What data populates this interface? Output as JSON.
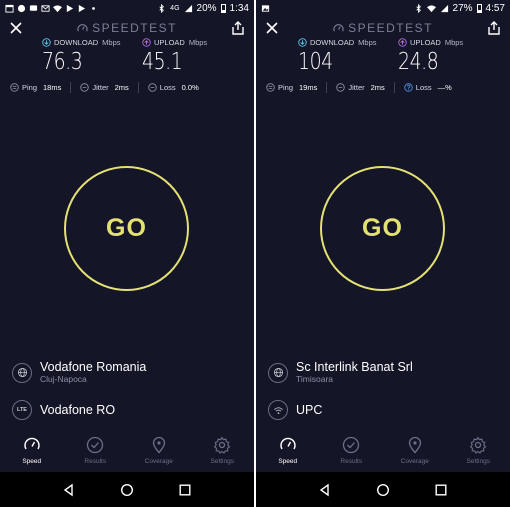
{
  "screens": [
    {
      "status": {
        "signal": "4G",
        "battery": "20%",
        "time": "1:34"
      },
      "logo": "SPEEDTEST",
      "download": {
        "label": "DOWNLOAD",
        "unit": "Mbps",
        "value": "76.3"
      },
      "upload": {
        "label": "UPLOAD",
        "unit": "Mbps",
        "value": "45.1"
      },
      "ping": {
        "label": "Ping",
        "value": "18ms"
      },
      "jitter": {
        "label": "Jitter",
        "value": "2ms"
      },
      "loss": {
        "label": "Loss",
        "value": "0.0%"
      },
      "go_label": "GO",
      "isp": {
        "name": "Vodafone Romania",
        "location": "Cluj-Napoca"
      },
      "network": {
        "badge": "LTE",
        "name": "Vodafone RO"
      },
      "nav": [
        "Speed",
        "Results",
        "Coverage",
        "Settings"
      ]
    },
    {
      "status": {
        "signal": "",
        "battery": "27%",
        "time": "4:57"
      },
      "logo": "SPEEDTEST",
      "download": {
        "label": "DOWNLOAD",
        "unit": "Mbps",
        "value": "104"
      },
      "upload": {
        "label": "UPLOAD",
        "unit": "Mbps",
        "value": "24.8"
      },
      "ping": {
        "label": "Ping",
        "value": "19ms"
      },
      "jitter": {
        "label": "Jitter",
        "value": "2ms"
      },
      "loss": {
        "label": "Loss",
        "value": "—%"
      },
      "go_label": "GO",
      "isp": {
        "name": "Sc Interlink Banat Srl",
        "location": "Timisoara"
      },
      "network": {
        "badge": "",
        "name": "UPC"
      },
      "nav": [
        "Speed",
        "Results",
        "Coverage",
        "Settings"
      ]
    }
  ],
  "colors": {
    "background": "#141526",
    "go_ring": "#e3e173",
    "download_accent": "#5ec3e8",
    "upload_accent": "#b06ae0",
    "loss_warning": "#4a90e2"
  }
}
